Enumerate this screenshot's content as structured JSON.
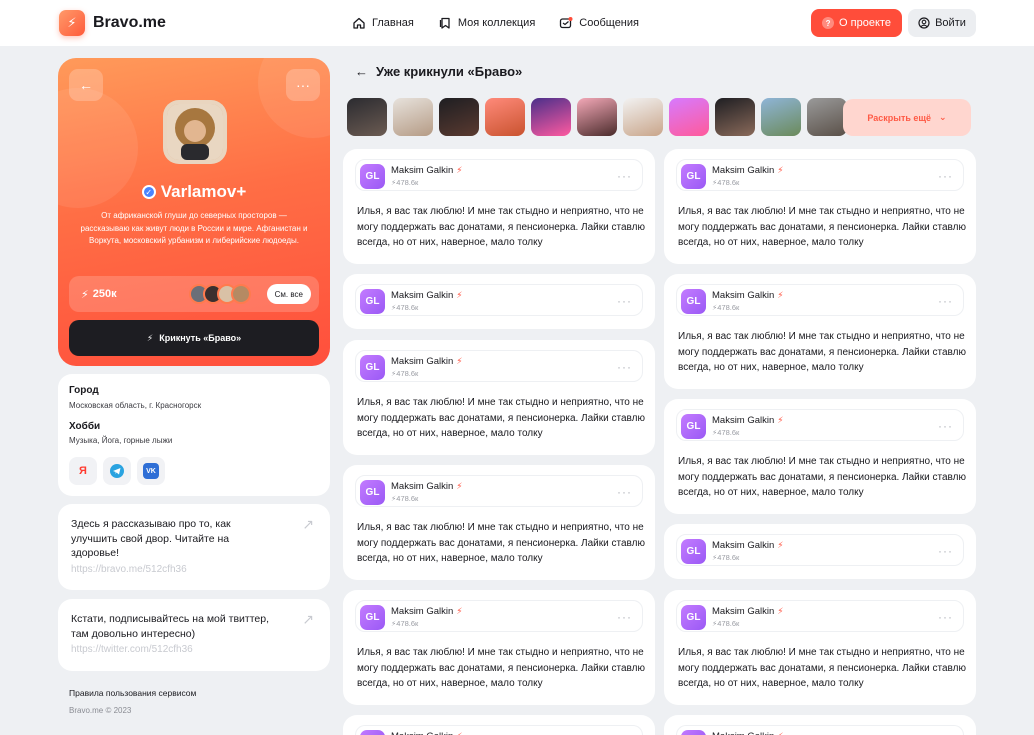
{
  "header": {
    "brand": "Bravo.me",
    "nav": [
      {
        "label": "Главная",
        "icon": "home-icon"
      },
      {
        "label": "Моя коллекция",
        "icon": "collection-icon"
      },
      {
        "label": "Сообщения",
        "icon": "messages-icon"
      }
    ],
    "about_label": "О проекте",
    "login_label": "Войти"
  },
  "profile": {
    "name": "Varlamov+",
    "description": "От африканской глуши до северных просторов — рассказываю как живут люди в России и мире. Афганистан и Воркута, московский урбанизм и либерийские людоеды.",
    "bravo_count": "250к",
    "see_all_label": "См. все",
    "shout_label": "Крикнуть «Браво»"
  },
  "info": {
    "city_label": "Город",
    "city_value": "Московская область, г. Красногорск",
    "hobby_label": "Хобби",
    "hobby_value": "Музыка, Йога, горные лыжи",
    "socials": [
      {
        "label": "Я",
        "icon": "yandex-icon",
        "color": "#ff3b30"
      },
      {
        "label": "➤",
        "icon": "telegram-icon",
        "color": "#2aa3e0"
      },
      {
        "label": "VK",
        "icon": "vk-icon",
        "color": "#2f6fd6"
      }
    ]
  },
  "links": [
    {
      "text": "Здесь я рассказываю про то, как улучшить свой двор. Читайте на здоровье!",
      "url": "https://bravo.me/512cfh36"
    },
    {
      "text": "Кстати, подписывайтесь на мой твиттер, там довольно интересно)",
      "url": "https://twitter.com/512cfh36"
    }
  ],
  "footer": {
    "rules": "Правила пользования сервисом",
    "copyright": "Bravo.me © 2023"
  },
  "feed": {
    "title": "Уже крикнули «Браво»",
    "reveal_label": "Раскрыть ещё",
    "post_author": "Maksim Galkin",
    "post_initials": "GL",
    "post_count": "478.6к",
    "post_text": "Илья, я вас так люблю! И мне так стыдно и неприятно, что не могу поддержать вас донатами, я пенсионерка. Лайки ставлю всегда, но от них, наверное, мало толку"
  },
  "colors": {
    "accent": "#ff4d3a",
    "profile_gradient_start": "#ff9a5a",
    "profile_gradient_end": "#ff4f3c",
    "dark_button": "#1d1d22",
    "avatar_purple": "#9a59f5"
  }
}
